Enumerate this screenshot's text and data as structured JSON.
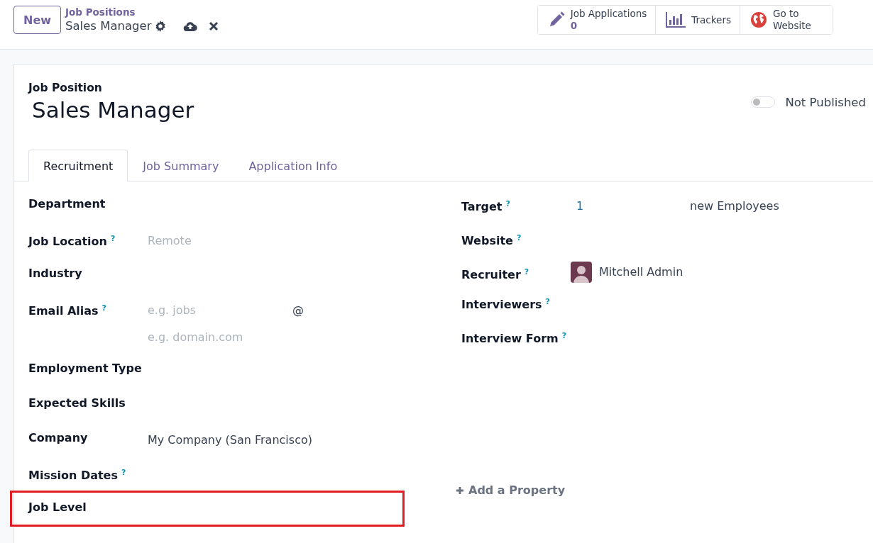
{
  "control_panel": {
    "new_button": "New",
    "breadcrumb": "Job Positions",
    "record_name": "Sales Manager"
  },
  "smart_buttons": [
    {
      "kind": "count",
      "label": "Job Applications",
      "count": "0"
    },
    {
      "kind": "trackers",
      "label": "Trackers"
    },
    {
      "kind": "website",
      "label": "Go to Website"
    }
  ],
  "form": {
    "title_label": "Job Position",
    "title": "Sales Manager",
    "published": {
      "on": false,
      "label": "Not Published"
    },
    "tabs": [
      {
        "label": "Recruitment",
        "selected": true
      },
      {
        "label": "Job Summary",
        "selected": false
      },
      {
        "label": "Application Info",
        "selected": false
      }
    ],
    "left_fields": [
      {
        "kind": "text",
        "label": "Department",
        "highlight": false
      },
      {
        "kind": "text",
        "label": "Job Location",
        "help": "?",
        "placeholder": "Remote",
        "highlight": false
      },
      {
        "kind": "text",
        "label": "Industry",
        "highlight": false
      },
      {
        "kind": "alias",
        "label": "Email Alias",
        "help": "?",
        "placeholder": "e.g. jobs",
        "separator": "@",
        "domain_placeholder": "e.g. domain.com",
        "highlight": false
      },
      {
        "kind": "text",
        "label": "Employment Type",
        "highlight": false
      },
      {
        "kind": "text",
        "label": "Expected Skills",
        "highlight": false
      },
      {
        "kind": "text",
        "label": "Company",
        "value": "My Company (San Francisco)",
        "highlight": false
      },
      {
        "kind": "text",
        "label": "Mission Dates",
        "help": "?",
        "highlight": false
      },
      {
        "kind": "text",
        "label": "Job Level",
        "highlight": true
      }
    ],
    "right_fields": [
      {
        "kind": "target",
        "label": "Target",
        "help": "?",
        "value": "1",
        "unit": "new Employees"
      },
      {
        "kind": "text",
        "label": "Website",
        "help": "?"
      },
      {
        "kind": "user",
        "label": "Recruiter",
        "help": "?",
        "value": "Mitchell Admin"
      },
      {
        "kind": "text",
        "label": "Interviewers",
        "help": "?"
      },
      {
        "kind": "text",
        "label": "Interview Form",
        "help": "?"
      }
    ],
    "add_property": "Add a Property"
  }
}
